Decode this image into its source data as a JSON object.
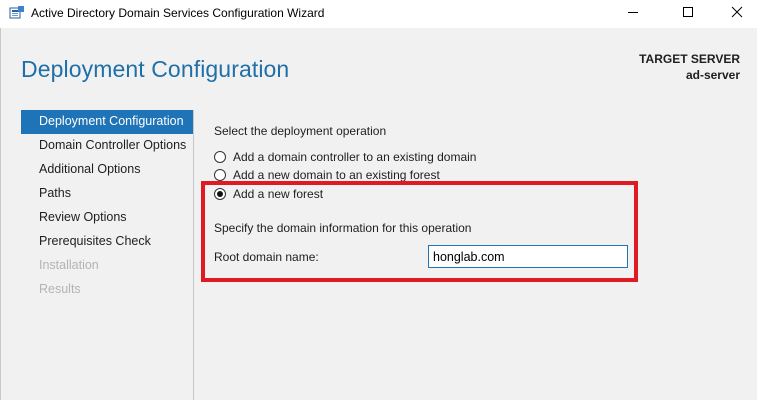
{
  "window": {
    "title": "Active Directory Domain Services Configuration Wizard"
  },
  "header": {
    "title": "Deployment Configuration",
    "target_label": "TARGET SERVER",
    "target_name": "ad-server"
  },
  "nav": {
    "items": [
      {
        "label": "Deployment Configuration",
        "state": "active"
      },
      {
        "label": "Domain Controller Options",
        "state": "enabled"
      },
      {
        "label": "Additional Options",
        "state": "enabled"
      },
      {
        "label": "Paths",
        "state": "enabled"
      },
      {
        "label": "Review Options",
        "state": "enabled"
      },
      {
        "label": "Prerequisites Check",
        "state": "enabled"
      },
      {
        "label": "Installation",
        "state": "disabled"
      },
      {
        "label": "Results",
        "state": "disabled"
      }
    ]
  },
  "main": {
    "operation_label": "Select the deployment operation",
    "options": [
      {
        "label": "Add a domain controller to an existing domain",
        "checked": false
      },
      {
        "label": "Add a new domain to an existing forest",
        "checked": false
      },
      {
        "label": "Add a new forest",
        "checked": true
      }
    ],
    "domain_info_label": "Specify the domain information for this operation",
    "root_domain_label": "Root domain name:",
    "root_domain_value": "honglab.com"
  },
  "colors": {
    "accent": "#1f74b8",
    "title": "#1f6fa8",
    "highlight": "#e01a22",
    "background": "#f1f1f1"
  },
  "icons": [
    "server-manager-icon",
    "minimize-icon",
    "maximize-icon",
    "close-icon"
  ]
}
